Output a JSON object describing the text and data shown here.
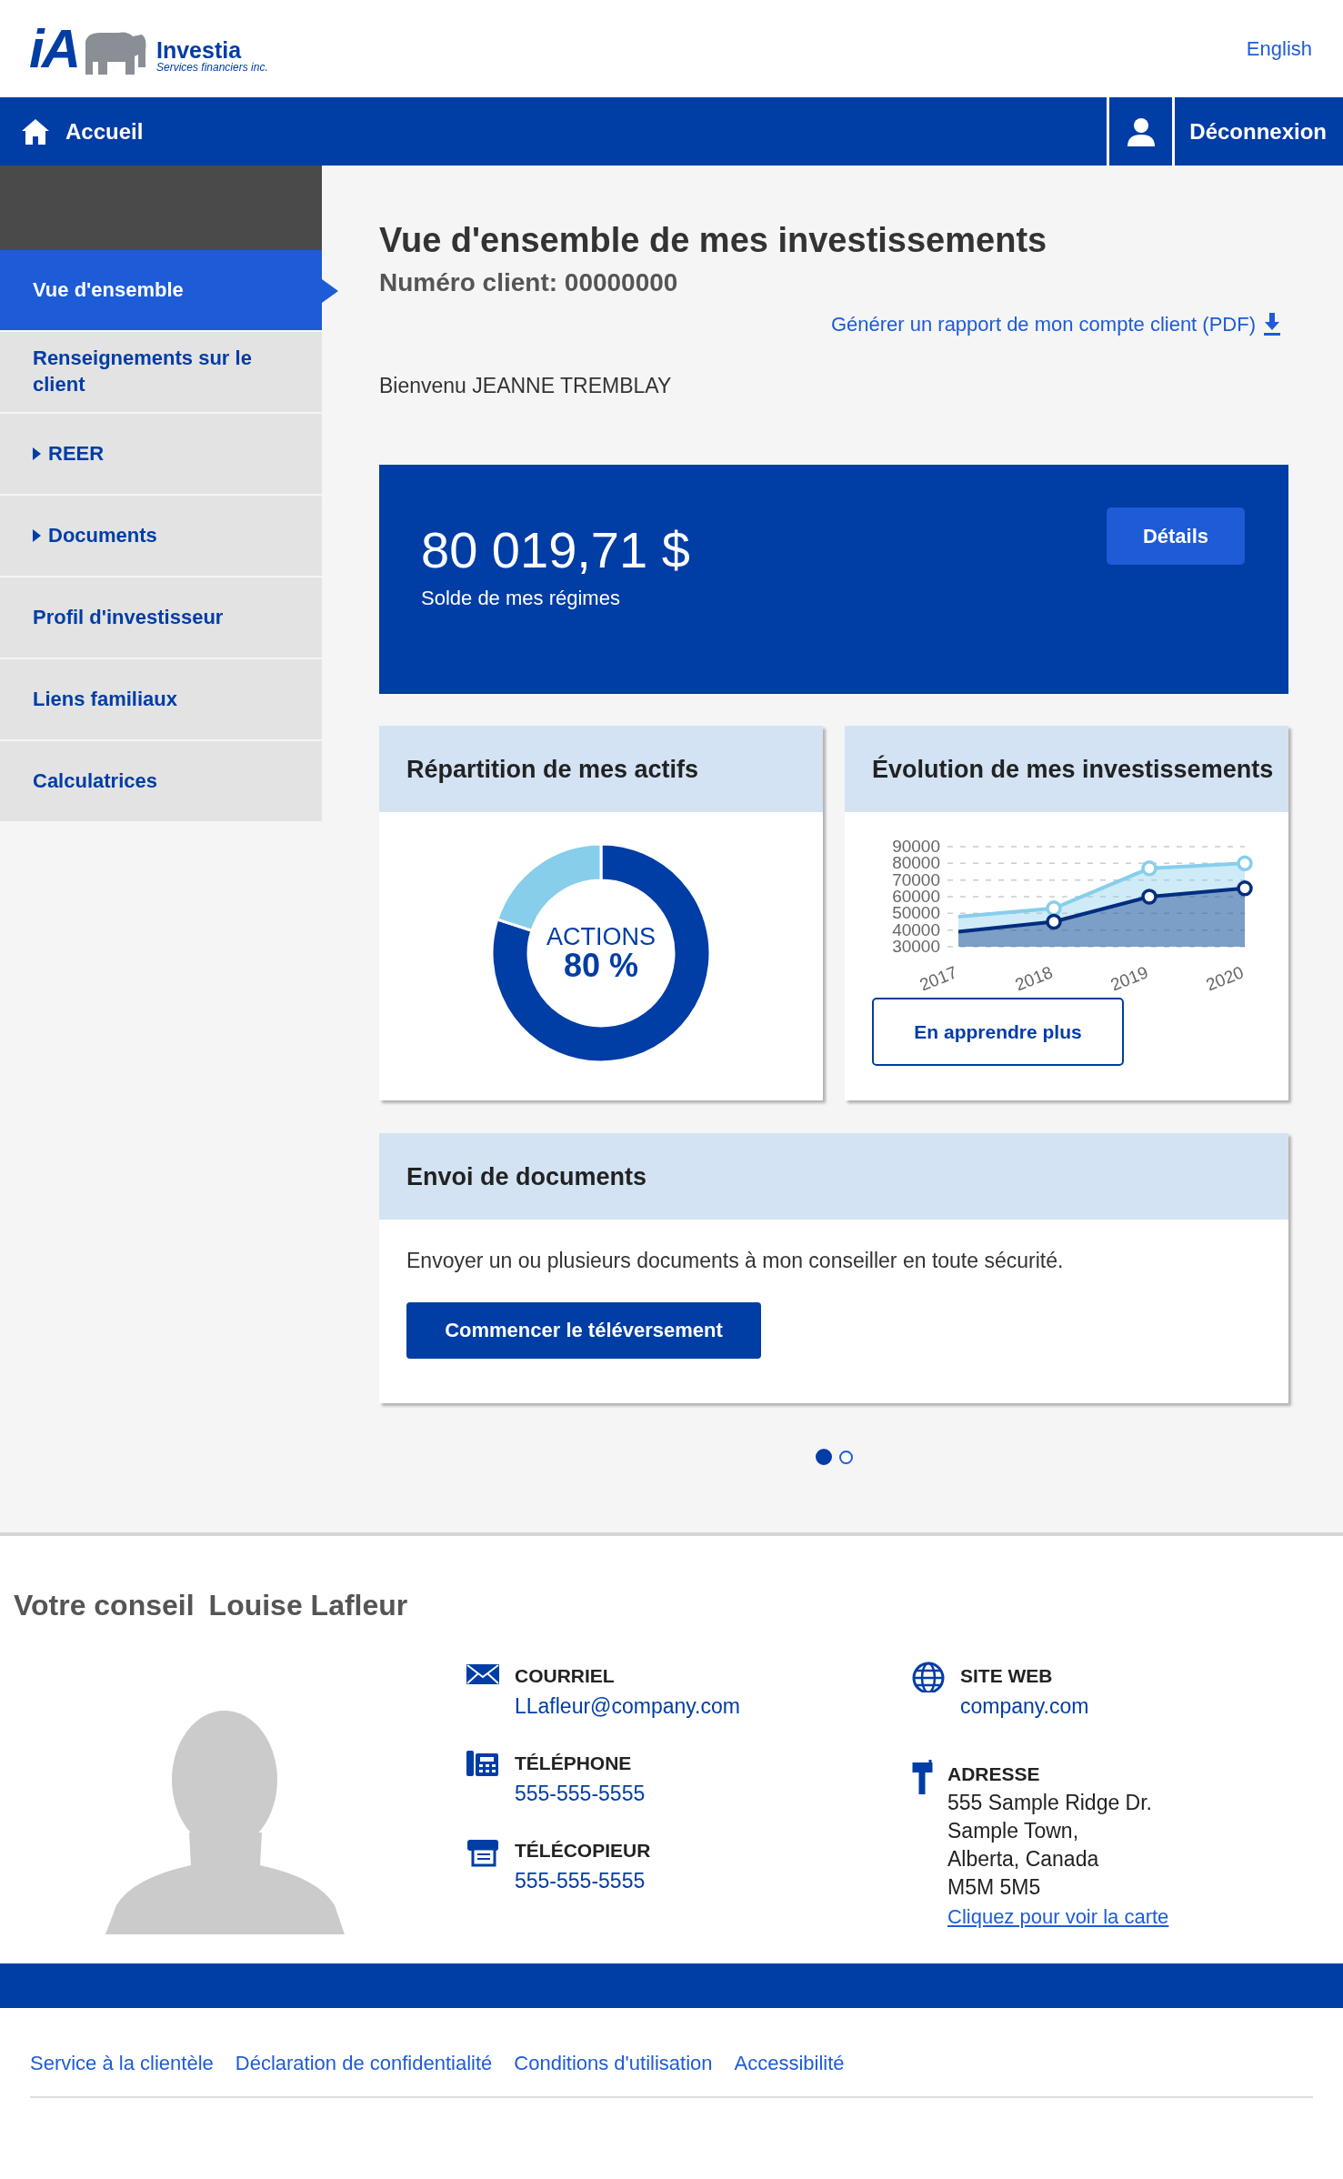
{
  "header": {
    "logo": {
      "mark": "iA",
      "name": "Investia",
      "tagline": "Services financiers inc."
    },
    "language_link": "English"
  },
  "navbar": {
    "home": "Accueil",
    "logout": "Déconnexion"
  },
  "sidebar": {
    "items": [
      {
        "label": "Vue d'ensemble",
        "kind": "link",
        "selected": true
      },
      {
        "label": "Renseignements sur le client",
        "kind": "link",
        "selected": false
      },
      {
        "label": "REER",
        "kind": "group",
        "expanded": false,
        "selected": false
      },
      {
        "label": "Documents",
        "kind": "group",
        "expanded": false,
        "selected": false
      },
      {
        "label": "Profil d'investisseur",
        "kind": "link",
        "selected": false
      },
      {
        "label": "Liens familiaux",
        "kind": "link",
        "selected": false
      },
      {
        "label": "Calculatrices",
        "kind": "link",
        "selected": false
      }
    ]
  },
  "overview": {
    "title": "Vue d'ensemble de mes investissements",
    "client_number": "Numéro client: 00000000",
    "report_link": "Générer un rapport de mon compte client (PDF)",
    "welcome": "Bienvenu JEANNE TREMBLAY"
  },
  "balance": {
    "amount": "80 019,71 $",
    "label": "Solde de mes régimes",
    "button": "Détails"
  },
  "cards": [
    {
      "title": "Répartition de mes actifs",
      "center_label": "ACTIONS",
      "center_value": "80 %",
      "chart_data": {
        "type": "donut",
        "values": [
          80,
          20
        ]
      }
    },
    {
      "title": "Évolution de mes investissements",
      "button": "En apprendre plus",
      "chart_data": {
        "type": "area",
        "x": [
          "2017",
          "2018",
          "2019",
          "2020"
        ],
        "ylim": [
          30000,
          90000
        ],
        "grid": true,
        "yticks": [
          30000,
          40000,
          50000,
          60000,
          70000,
          80000,
          90000
        ],
        "series": [
          {
            "color": "#87ceeb",
            "values": [
              48000,
              53000,
              77000,
              80000
            ]
          },
          {
            "color": "#002d80",
            "values": [
              39000,
              45000,
              60000,
              65000
            ]
          }
        ]
      }
    }
  ],
  "documents": {
    "title": "Envoi de documents",
    "text": "Envoyer un ou plusieurs documents à mon conseiller en toute sécurité.",
    "button": "Commencer le téléversement"
  },
  "carousel_dots": [
    {
      "selected": true
    },
    {
      "selected": false
    }
  ],
  "advisor": {
    "heading": "Votre conseil",
    "name": "Louise Lafleur",
    "columns": [
      [
        {
          "kind": "email",
          "label": "COURRIEL",
          "value": "LLafleur@company.com"
        },
        {
          "kind": "phone",
          "label": "TÉLÉPHONE",
          "value": "555-555-5555"
        },
        {
          "kind": "fax",
          "label": "TÉLÉCOPIEUR",
          "value": "555-555-5555"
        }
      ],
      [
        {
          "kind": "web",
          "label": "SITE WEB",
          "value": "company.com"
        },
        {
          "kind": "address",
          "label": "ADRESSE",
          "lines": [
            "555 Sample Ridge Dr.",
            "Sample Town,",
            "Alberta, Canada",
            "M5M 5M5"
          ],
          "link": "Cliquez pour voir la carte"
        }
      ]
    ]
  },
  "footer": {
    "links": [
      "Service à la clientèle",
      "Déclaration de confidentialité",
      "Conditions d'utilisation",
      "Accessibilité"
    ]
  }
}
